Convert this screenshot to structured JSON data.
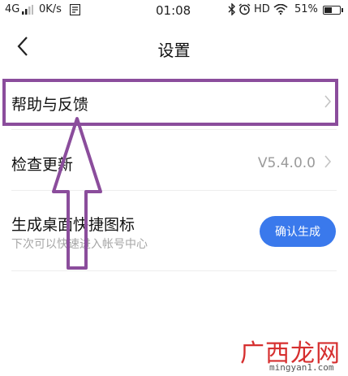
{
  "status_bar": {
    "network": "4G",
    "speed": "0K/s",
    "time": "01:08",
    "hd": "HD",
    "battery_text": "51%",
    "battery_level": 0.51
  },
  "nav": {
    "title": "设置",
    "back_icon": "chevron-left-icon"
  },
  "settings": {
    "help_label": "帮助与反馈",
    "update_label": "检查更新",
    "version": "V5.4.0.0",
    "shortcut_label": "生成桌面快捷图标",
    "shortcut_desc": "下次可以快速进入帐号中心",
    "shortcut_button": "确认生成"
  },
  "annotation": {
    "color": "#8b4d9c"
  },
  "watermark": {
    "brand": "广西龙网",
    "url": "mingyan1.com"
  },
  "colors": {
    "accent": "#3a79ec",
    "annotation": "#8b4d9c"
  }
}
